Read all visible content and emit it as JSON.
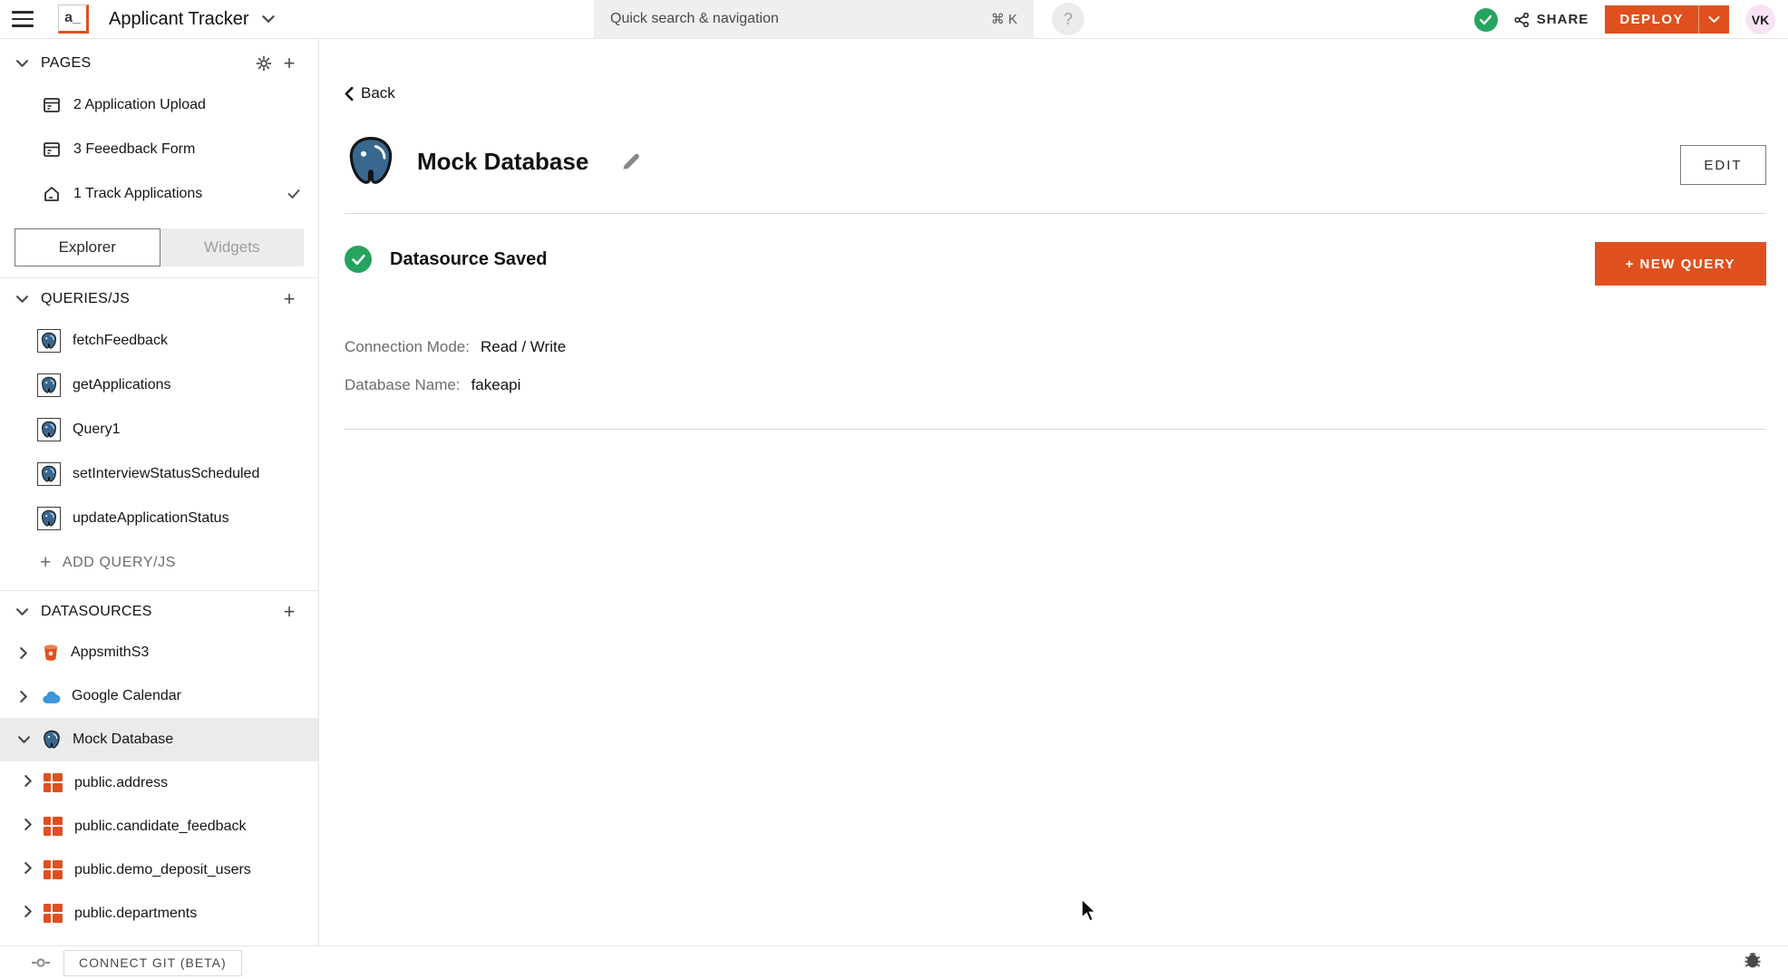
{
  "topbar": {
    "app_title": "Applicant Tracker",
    "logo_text": "a_",
    "search_placeholder": "Quick search & navigation",
    "search_shortcut": "⌘ K",
    "help_label": "?",
    "share_label": "SHARE",
    "deploy_label": "DEPLOY",
    "avatar_initials": "VK"
  },
  "sidebar": {
    "pages": {
      "title": "PAGES",
      "items": [
        {
          "label": "2 Application Upload"
        },
        {
          "label": "3 Feeedback Form"
        },
        {
          "label": "1 Track Applications"
        }
      ]
    },
    "tabs": {
      "explorer": "Explorer",
      "widgets": "Widgets"
    },
    "queries": {
      "title": "QUERIES/JS",
      "items": [
        "fetchFeedback",
        "getApplications",
        "Query1",
        "setInterviewStatusScheduled",
        "updateApplicationStatus"
      ],
      "add_label": "ADD QUERY/JS"
    },
    "datasources": {
      "title": "DATASOURCES",
      "items": [
        {
          "label": "AppsmithS3"
        },
        {
          "label": "Google Calendar"
        },
        {
          "label": "Mock Database"
        }
      ],
      "tables": [
        "public.address",
        "public.candidate_feedback",
        "public.demo_deposit_users",
        "public.departments"
      ]
    }
  },
  "bottombar": {
    "connect_git_label": "CONNECT GIT (BETA)"
  },
  "main": {
    "back_label": "Back",
    "title": "Mock Database",
    "edit_label": "EDIT",
    "saved_status": "Datasource Saved",
    "new_query_label": "+ NEW QUERY",
    "fields": [
      {
        "label": "Connection Mode:",
        "value": "Read / Write"
      },
      {
        "label": "Database Name:",
        "value": "fakeapi"
      }
    ]
  },
  "colors": {
    "accent_orange": "#e0501e",
    "success_green": "#26a45e",
    "selected_row": "#ebebeb",
    "search_bg": "#efefef",
    "avatar_bg": "#f7e3f4"
  }
}
